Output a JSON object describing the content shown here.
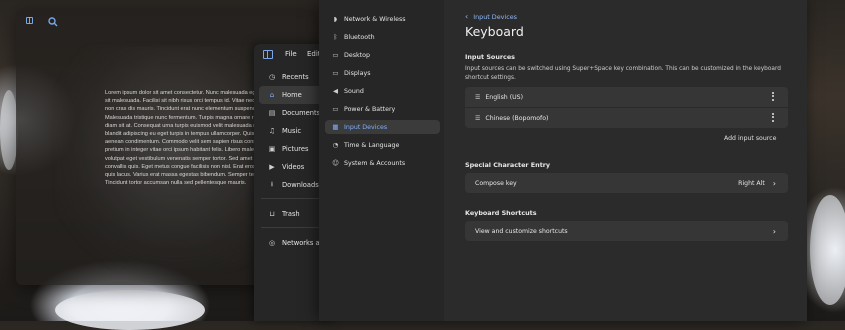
{
  "editor": {
    "body_text": "Lorem ipsum dolor sit amet consectetur. Nunc malesuada egestas etiam sit malesuada. Facilisi sit nibh risus orci tempus id. Vitae neque et enim non cras dis mauris. Tincidunt erat nunc elementum suspendisse ipsum. Malesuada tristique nunc fermentum. Turpis magna ornare risus duis duis diam sit at. Consequat urna turpis euismod velit malesuada nullam. Turpis blandit adipiscing eu eget turpis in tempus ullamcorper. Quis amet mauris aenean condimentum. Commodo velit sem sapien risus consectetur erat pretium in integer vitae orci ipsum habitant felis. Libero malesuada volutpat eget vestibulum venenatis semper tortor. Sed amet sit volutpat vel convallis quis. Eget metus congue facilisis non nisl. Erat eros consectetur quis lacus. Varius erat massa egestas bibendum. Semper tellus vel amet. Tincidunt tortor accumsan nulla sed pellentesque mauris."
  },
  "files": {
    "menu": [
      "File",
      "Edit"
    ],
    "places": [
      {
        "icon": "clock-icon",
        "glyph": "◷",
        "label": "Recents"
      },
      {
        "icon": "home-icon",
        "glyph": "⌂",
        "label": "Home",
        "active": true
      },
      {
        "icon": "document-icon",
        "glyph": "▤",
        "label": "Documents"
      },
      {
        "icon": "music-icon",
        "glyph": "♫",
        "label": "Music"
      },
      {
        "icon": "picture-icon",
        "glyph": "▣",
        "label": "Pictures"
      },
      {
        "icon": "video-icon",
        "glyph": "▶",
        "label": "Videos"
      },
      {
        "icon": "download-icon",
        "glyph": "⭳",
        "label": "Downloads"
      },
      {
        "icon": "trash-icon",
        "glyph": "⊔",
        "label": "Trash"
      }
    ],
    "networks_label": "Networks and"
  },
  "settings_sidebar": [
    {
      "icon": "wifi-icon",
      "glyph": "◗",
      "label": "Network & Wireless"
    },
    {
      "icon": "bluetooth-icon",
      "glyph": "ᛒ",
      "label": "Bluetooth"
    },
    {
      "icon": "desktop-icon",
      "glyph": "▭",
      "label": "Desktop"
    },
    {
      "icon": "display-icon",
      "glyph": "▭",
      "label": "Displays"
    },
    {
      "icon": "sound-icon",
      "glyph": "◀",
      "label": "Sound"
    },
    {
      "icon": "battery-icon",
      "glyph": "▭",
      "label": "Power & Battery"
    },
    {
      "icon": "keyboard-icon",
      "glyph": "▦",
      "label": "Input Devices",
      "active": true
    },
    {
      "icon": "time-icon",
      "glyph": "◔",
      "label": "Time & Language"
    },
    {
      "icon": "users-icon",
      "glyph": "☺",
      "label": "System & Accounts"
    }
  ],
  "content": {
    "breadcrumb": "Input Devices",
    "title": "Keyboard",
    "input_sources": {
      "heading": "Input Sources",
      "description": "Input sources can be switched using Super+Space key combination. This can be customized in the keyboard shortcut settings.",
      "items": [
        "English (US)",
        "Chinese (Bopomofo)"
      ],
      "add_label": "Add input source"
    },
    "special_char": {
      "heading": "Special Character Entry",
      "row_label": "Compose key",
      "row_value": "Right Alt"
    },
    "shortcuts": {
      "heading": "Keyboard Shortcuts",
      "row_label": "View and customize shortcuts"
    }
  },
  "colors": {
    "accent": "#7fb0ff"
  }
}
